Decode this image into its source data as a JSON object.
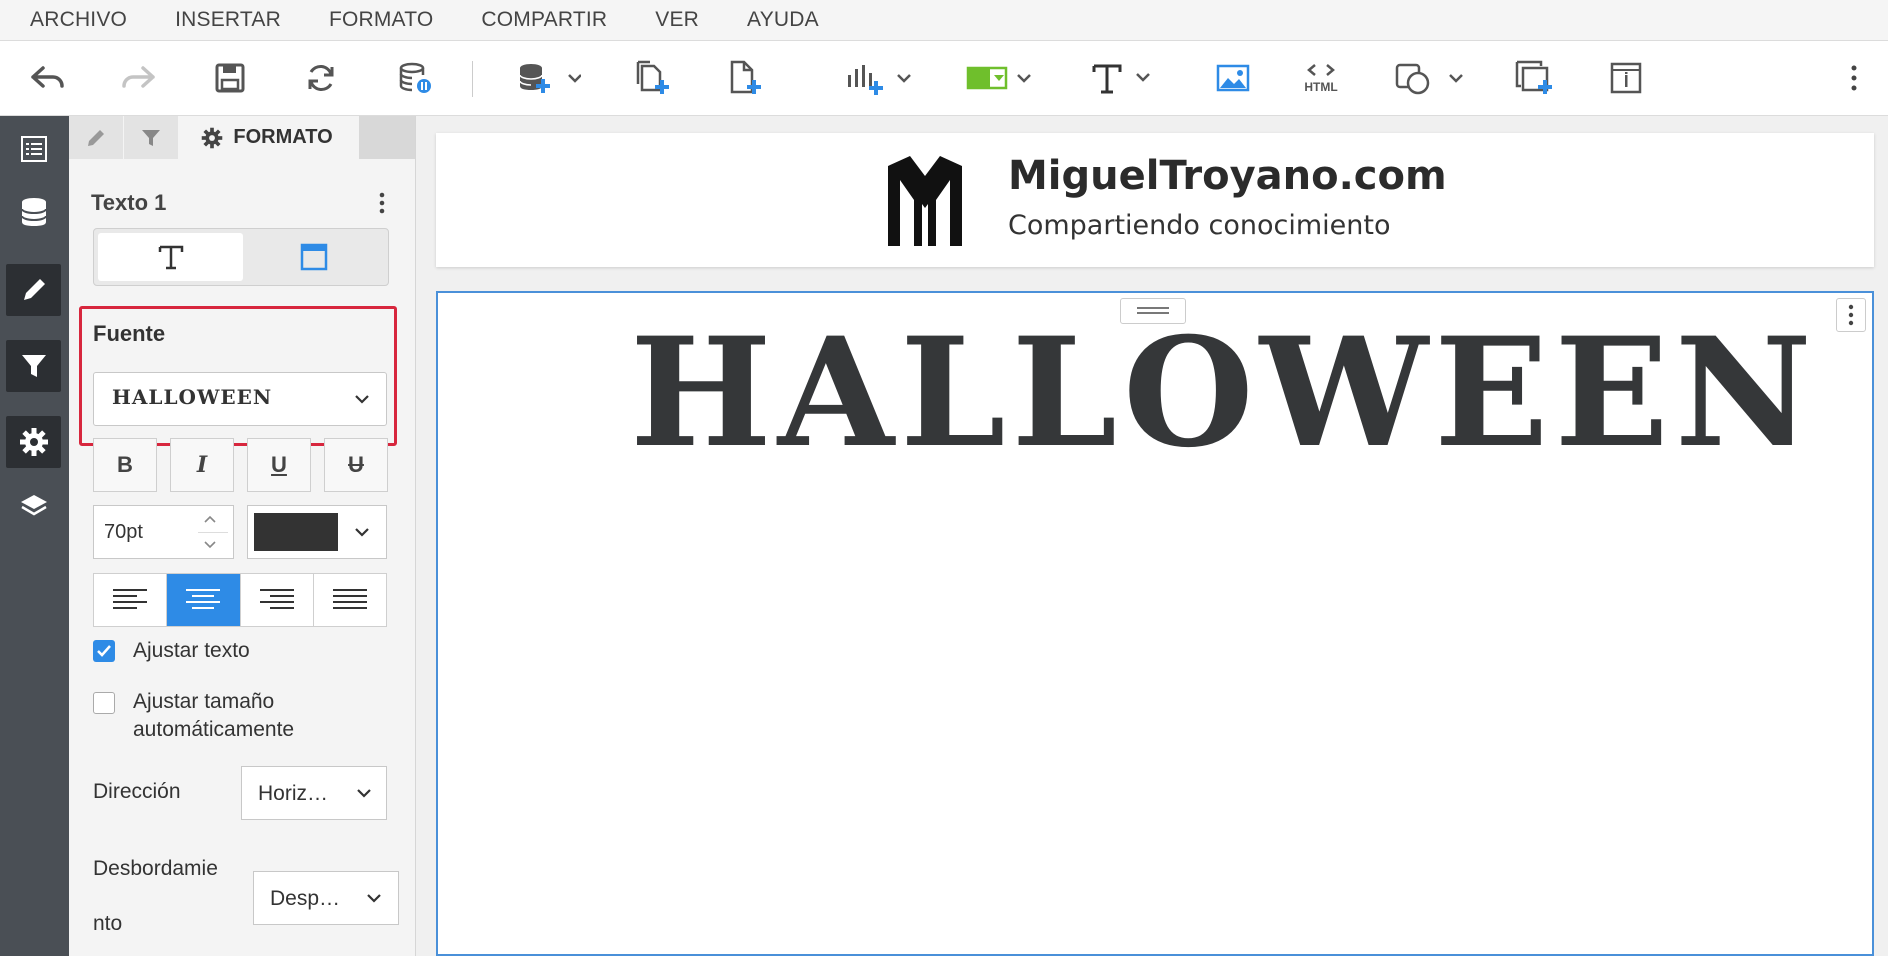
{
  "menu": [
    "ARCHIVO",
    "INSERTAR",
    "FORMATO",
    "COMPARTIR",
    "VER",
    "AYUDA"
  ],
  "toolbar": {
    "html_label": "HTML",
    "icons": [
      "undo-icon",
      "redo-icon",
      "save-icon",
      "refresh-icon",
      "data-pause-icon",
      "add-datasource-icon",
      "duplicate-page-icon",
      "new-page-icon",
      "add-chart-icon",
      "add-filter-control-icon",
      "add-text-icon",
      "add-image-icon",
      "html-embed-icon",
      "add-shape-icon",
      "new-layer-icon",
      "info-icon",
      "more-icon"
    ],
    "accent": "#2e8be6",
    "filter_green": "#6fbf2c"
  },
  "panel": {
    "tab_label": "FORMATO",
    "element_title": "Texto 1",
    "font_section": "Fuente",
    "font_selected": "HALLOWEEN",
    "bold": "B",
    "italic": "I",
    "underline": "U",
    "strike": "U",
    "font_size": "70pt",
    "text_color": "#333333",
    "wrap_text": "Ajustar texto",
    "autosize_line1": "Ajustar tamaño",
    "autosize_line2": "automáticamente",
    "direction_label": "Dirección",
    "direction_value": "Horiz…",
    "overflow_label_1": "Desbordamie",
    "overflow_label_2": "nto",
    "overflow_value": "Desp…",
    "highlight_color": "#d7263d"
  },
  "canvas": {
    "brand_name": "MiguelTroyano.com",
    "brand_tagline": "Compartiendo conocimiento",
    "text_content": "HALLOWEEN"
  }
}
